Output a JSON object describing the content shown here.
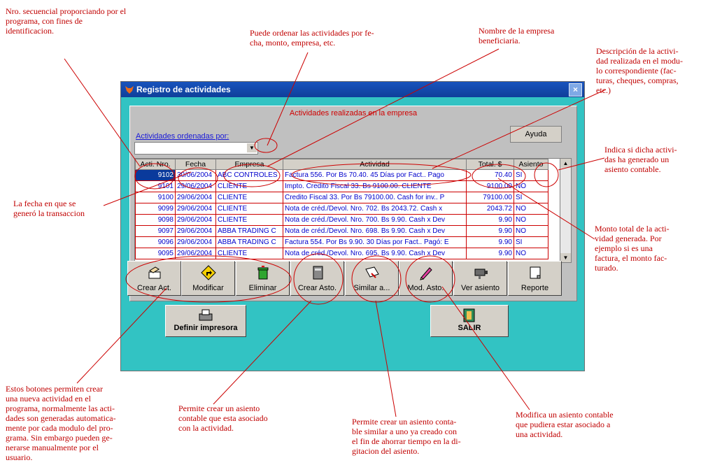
{
  "window": {
    "title": "Registro de actividades",
    "close": "×"
  },
  "panel": {
    "title": "Actividades realizadas en la empresa",
    "order_label": "Actividades ordenadas por:",
    "order_value": "",
    "help_button": "Ayuda"
  },
  "grid": {
    "columns": [
      "Acti. Nro.",
      "Fecha",
      "Empresa",
      "Actividad",
      "Total. $",
      "Asiento"
    ],
    "rows": [
      [
        "9102",
        "30/06/2004",
        "ABC CONTROLES",
        "Factura 556. Por Bs 70.40. 45 Días por Fact.. Pago",
        "70.40",
        "SI"
      ],
      [
        "9101",
        "29/06/2004",
        "CLIENTE",
        "Impto. Credito Fiscal 33. Bs 9100.00. CLIENTE",
        "9100.00",
        "NO"
      ],
      [
        "9100",
        "29/06/2004",
        "CLIENTE",
        "Credito Fiscal 33. Por Bs 79100.00. Cash for inv.. P",
        "79100.00",
        "SI"
      ],
      [
        "9099",
        "29/06/2004",
        "CLIENTE",
        "Nota de créd./Devol. Nro. 702. Bs 2043.72. Cash x",
        "2043.72",
        "NO"
      ],
      [
        "9098",
        "29/06/2004",
        "CLIENTE",
        "Nota de créd./Devol. Nro. 700. Bs 9.90. Cash x Dev",
        "9.90",
        "NO"
      ],
      [
        "9097",
        "29/06/2004",
        "ABBA TRADING C",
        "Nota de créd./Devol. Nro. 698. Bs 9.90. Cash x Dev",
        "9.90",
        "NO"
      ],
      [
        "9096",
        "29/06/2004",
        "ABBA TRADING C",
        "Factura 554. Por Bs 9.90. 30 Días por Fact.. Pagó: E",
        "9.90",
        "SI"
      ],
      [
        "9095",
        "29/06/2004",
        "CLIENTE",
        "Nota de créd./Devol. Nro. 695. Bs 9.90. Cash x Dev",
        "9.90",
        "NO"
      ]
    ]
  },
  "toolbar": [
    "Crear Act.",
    "Modificar",
    "Eliminar",
    "Crear Asto.",
    "Similar a...",
    "Mod. Asto.",
    "Ver asiento",
    "Reporte"
  ],
  "bottom": {
    "printer": "Definir impresora",
    "exit": "SALIR"
  },
  "notes": {
    "n1": "Nro. secuencial proporciando por el\nprograma, con fines de\nidentificacion.",
    "n2": "Puede ordenar las actividades por fe-\ncha, monto, empresa, etc.",
    "n3": "Nombre de la empresa\nbeneficiaria.",
    "n4": "Descripción de la activi-\ndad realizada en el modu-\nlo correspondiente (fac-\nturas, cheques, compras,\netc.)",
    "n5": "Indica si dicha activi-\ndas ha generado un\nasiento contable.",
    "n6": "La fecha en que se\ngeneró la transaccion",
    "n7": "Monto total de la acti-\nvidad generada. Por\nejemplo si es una\nfactura, el monto fac-\nturado.",
    "n8": "Estos botones permiten crear\nuna nueva actividad en el\nprograma, normalmente las acti-\ndades son generadas automatica-\nmente por cada modulo del pro-\ngrama. Sin embargo pueden ge-\nnerarse manualmente por el\nusuario.",
    "n9": "Permite crear un asiento\ncontable que esta asociado\ncon la actividad.",
    "n10": "Permite crear un asiento conta-\nble similar a uno ya creado con\nel fin de ahorrar tiempo en la di-\ngitacion del asiento.",
    "n11": "Modifica un asiento contable\nque pudiera estar asociado a\nuna actividad."
  }
}
